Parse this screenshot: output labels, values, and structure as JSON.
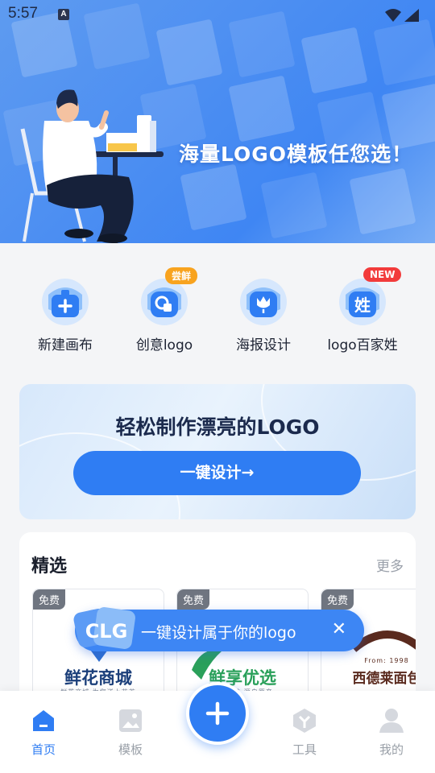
{
  "status_bar": {
    "time": "5:57",
    "notification_icon": "A"
  },
  "banner": {
    "title": "海量LOGO模板任您选！"
  },
  "quick_actions": [
    {
      "label": "新建画布",
      "icon": "plus-case-icon",
      "badge": ""
    },
    {
      "label": "创意logo",
      "icon": "shapes-icon",
      "badge": "尝鲜"
    },
    {
      "label": "海报设计",
      "icon": "tulip-icon",
      "badge": ""
    },
    {
      "label": "logo百家姓",
      "icon": "surname-icon",
      "badge": "NEW"
    }
  ],
  "cta": {
    "title": "轻松制作漂亮的LOGO",
    "button": "一键设计→"
  },
  "featured": {
    "title": "精选",
    "more": "更多",
    "cards": [
      {
        "tag": "免费",
        "name": "鲜花商城",
        "sub": "鲜花商城 为您送上芬芳"
      },
      {
        "tag": "免费",
        "name": "鲜享优选",
        "sub": "鲜享优选 源自原产"
      },
      {
        "tag": "免费",
        "name": "西德莱面包",
        "sub": "From: 1998"
      }
    ]
  },
  "toast": {
    "text": "一键设计属于你的logo",
    "close": "✕",
    "logo_letters": "CLG"
  },
  "tabbar": [
    {
      "label": "首页",
      "icon": "home-icon",
      "active": true
    },
    {
      "label": "模板",
      "icon": "template-icon",
      "active": false
    },
    {
      "label": "工具",
      "icon": "tools-icon",
      "active": false
    },
    {
      "label": "我的",
      "icon": "profile-icon",
      "active": false
    }
  ],
  "fab": {
    "label": "+"
  },
  "colors": {
    "primary": "#2f7df3",
    "banner": "#4d8ff2",
    "badge_orange": "#f8a31f",
    "badge_red": "#f23b3b"
  }
}
